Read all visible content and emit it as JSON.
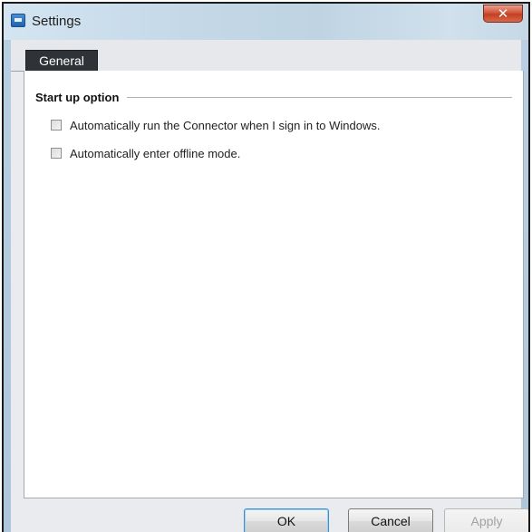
{
  "window": {
    "title": "Settings",
    "close_icon": "close-icon"
  },
  "tabs": [
    {
      "label": "General",
      "selected": true
    }
  ],
  "startup_group": {
    "title": "Start up option",
    "options": [
      {
        "label": "Automatically run the Connector when I sign in to Windows.",
        "checked": false
      },
      {
        "label": "Automatically enter offline mode.",
        "checked": false
      }
    ]
  },
  "buttons": {
    "ok": "OK",
    "cancel": "Cancel",
    "apply": "Apply"
  },
  "colors": {
    "close_button": "#c23f22",
    "tab_selected_bg": "#2f3337",
    "ok_button_focus": "#3b8fd0"
  }
}
